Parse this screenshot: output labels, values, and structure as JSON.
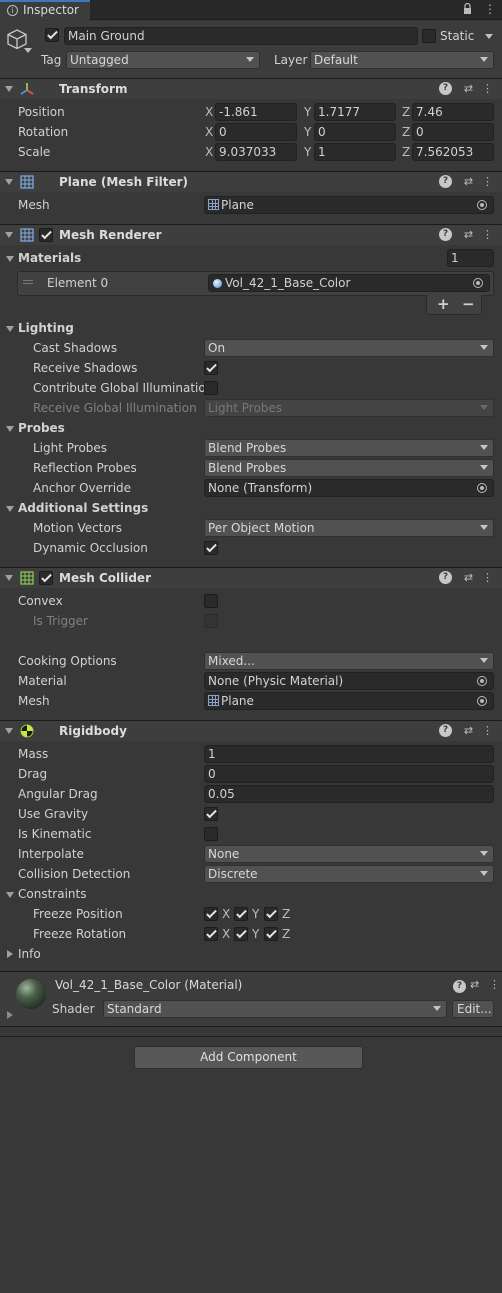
{
  "tab": {
    "title": "Inspector"
  },
  "object": {
    "name": "Main Ground",
    "active": true,
    "static_label": "Static",
    "tag_label": "Tag",
    "tag_value": "Untagged",
    "layer_label": "Layer",
    "layer_value": "Default"
  },
  "transform": {
    "title": "Transform",
    "position": {
      "label": "Position",
      "x": "-1.861",
      "y": "1.7177",
      "z": "7.46"
    },
    "rotation": {
      "label": "Rotation",
      "x": "0",
      "y": "0",
      "z": "0"
    },
    "scale": {
      "label": "Scale",
      "x": "9.037033",
      "y": "1",
      "z": "7.562053"
    },
    "axes": {
      "x": "X",
      "y": "Y",
      "z": "Z"
    }
  },
  "mesh_filter": {
    "title": "Plane (Mesh Filter)",
    "mesh_label": "Mesh",
    "mesh_value": "Plane"
  },
  "mesh_renderer": {
    "title": "Mesh Renderer",
    "materials_label": "Materials",
    "materials_count": "1",
    "element0_label": "Element 0",
    "element0_value": "Vol_42_1_Base_Color",
    "add": "+",
    "remove": "−",
    "lighting": {
      "title": "Lighting",
      "cast_shadows_label": "Cast Shadows",
      "cast_shadows_value": "On",
      "receive_shadows_label": "Receive Shadows",
      "contribute_gi_label": "Contribute Global Illumination",
      "receive_gi_label": "Receive Global Illumination",
      "receive_gi_value": "Light Probes"
    },
    "probes": {
      "title": "Probes",
      "light_probes_label": "Light Probes",
      "light_probes_value": "Blend Probes",
      "reflection_probes_label": "Reflection Probes",
      "reflection_probes_value": "Blend Probes",
      "anchor_label": "Anchor Override",
      "anchor_value": "None (Transform)"
    },
    "additional": {
      "title": "Additional Settings",
      "motion_vectors_label": "Motion Vectors",
      "motion_vectors_value": "Per Object Motion",
      "dynamic_occlusion_label": "Dynamic Occlusion"
    }
  },
  "mesh_collider": {
    "title": "Mesh Collider",
    "convex_label": "Convex",
    "is_trigger_label": "Is Trigger",
    "cooking_label": "Cooking Options",
    "cooking_value": "Mixed...",
    "material_label": "Material",
    "material_value": "None (Physic Material)",
    "mesh_label": "Mesh",
    "mesh_value": "Plane"
  },
  "rigidbody": {
    "title": "Rigidbody",
    "mass_label": "Mass",
    "mass_value": "1",
    "drag_label": "Drag",
    "drag_value": "0",
    "angular_drag_label": "Angular Drag",
    "angular_drag_value": "0.05",
    "use_gravity_label": "Use Gravity",
    "is_kinematic_label": "Is Kinematic",
    "interpolate_label": "Interpolate",
    "interpolate_value": "None",
    "collision_label": "Collision Detection",
    "collision_value": "Discrete",
    "constraints_label": "Constraints",
    "freeze_position_label": "Freeze Position",
    "freeze_rotation_label": "Freeze Rotation",
    "info_label": "Info"
  },
  "material": {
    "title": "Vol_42_1_Base_Color (Material)",
    "shader_label": "Shader",
    "shader_value": "Standard",
    "edit_label": "Edit..."
  },
  "footer": {
    "add_component": "Add Component"
  },
  "colors": {
    "background": "#383838",
    "header": "#3e3e3e",
    "field": "#2a2a2a",
    "dropdown": "#515151"
  }
}
